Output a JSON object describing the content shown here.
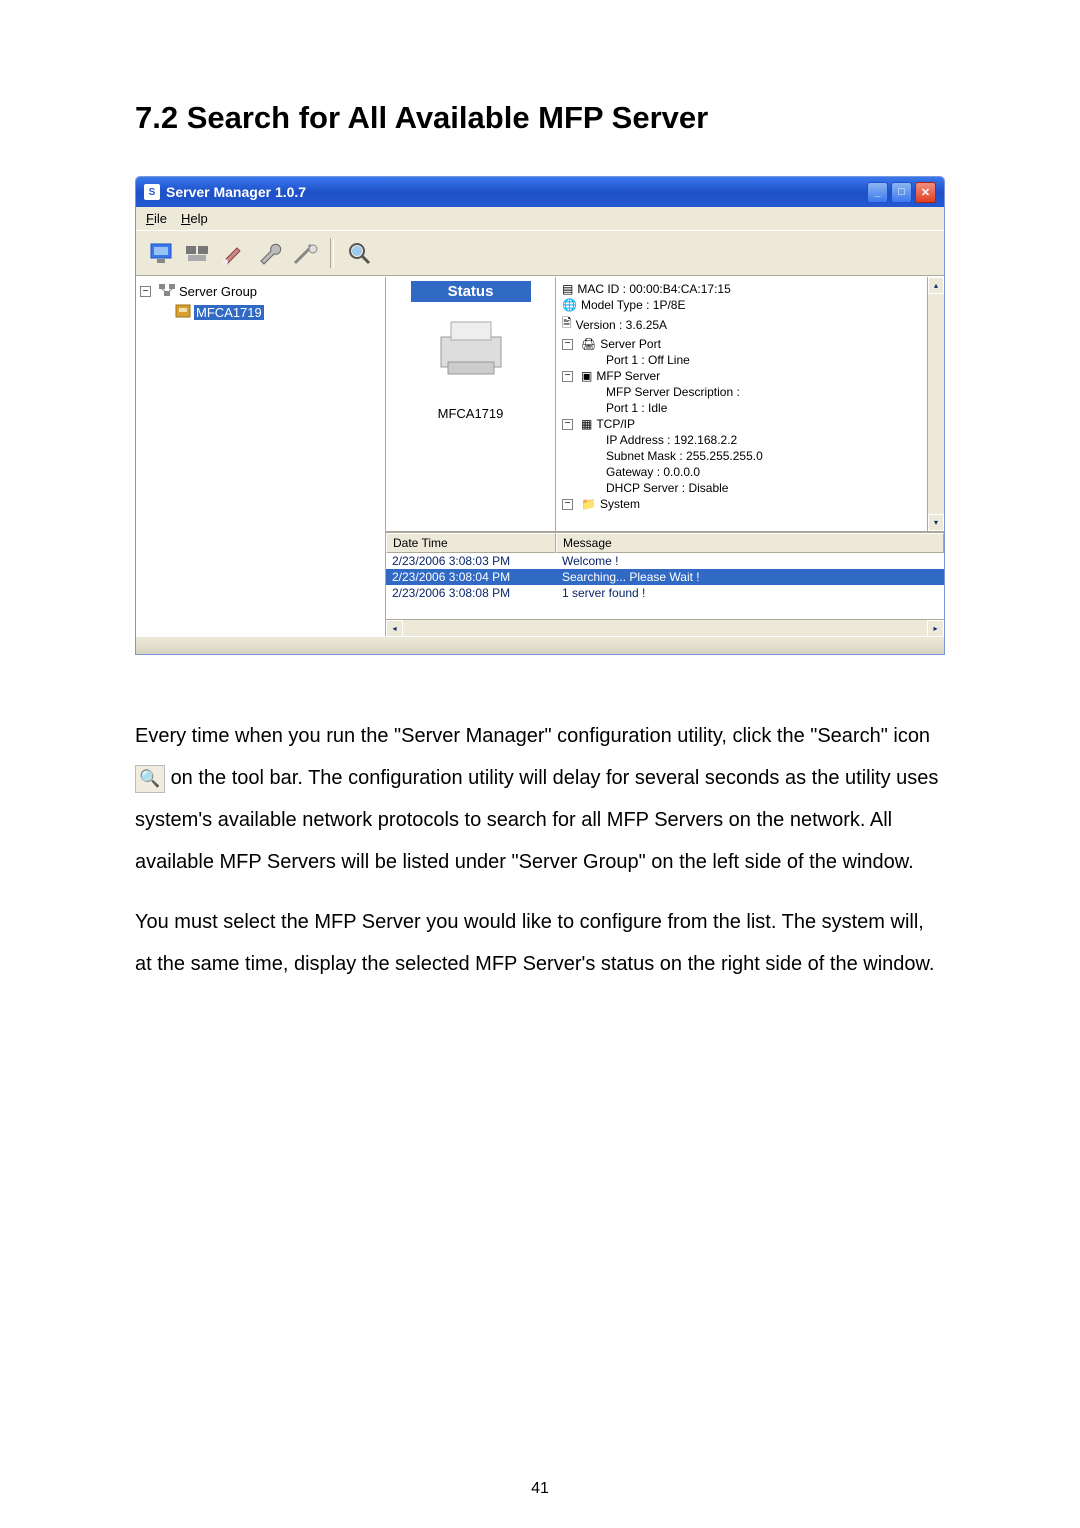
{
  "heading": "7.2    Search for All Available MFP Server",
  "window": {
    "title": "Server Manager 1.0.7",
    "menu": {
      "file": "File",
      "help": "Help"
    },
    "tree": {
      "root": "Server Group",
      "child": "MFCA1719"
    },
    "status": {
      "header": "Status",
      "device": "MFCA1719"
    },
    "details": {
      "mac": "MAC ID : 00:00:B4:CA:17:15",
      "model": "Model Type : 1P/8E",
      "version": "Version : 3.6.25A",
      "server_port_label": "Server Port",
      "port1_offline": "Port 1 : Off Line",
      "mfp_server_label": "MFP Server",
      "mfp_desc": "MFP Server Description :",
      "port1_idle": "Port 1 : Idle",
      "tcpip": "TCP/IP",
      "ip": "IP Address : 192.168.2.2",
      "subnet": "Subnet Mask : 255.255.255.0",
      "gateway": "Gateway : 0.0.0.0",
      "dhcp": "DHCP Server : Disable",
      "system": "System"
    },
    "log": {
      "headers": {
        "time": "Date Time",
        "msg": "Message"
      },
      "rows": [
        {
          "time": "2/23/2006 3:08:03 PM",
          "msg": "Welcome !"
        },
        {
          "time": "2/23/2006 3:08:04 PM",
          "msg": "Searching... Please Wait !"
        },
        {
          "time": "2/23/2006 3:08:08 PM",
          "msg": "1 server found !"
        }
      ]
    }
  },
  "body": {
    "para1a": "Every time when you run the \"Server Manager\" configuration utility, click the \"Search\" icon ",
    "para1b": " on the tool bar. The configuration utility will delay for several seconds as the utility uses system's available network protocols to search for all MFP Servers on the network. All available MFP Servers will be listed under \"Server Group\" on the left side of the window.",
    "para2": "You must select the MFP Server you would like to configure from the list. The system will, at the same time, display the selected MFP Server's status on the right side of the window."
  },
  "page_number": "41"
}
